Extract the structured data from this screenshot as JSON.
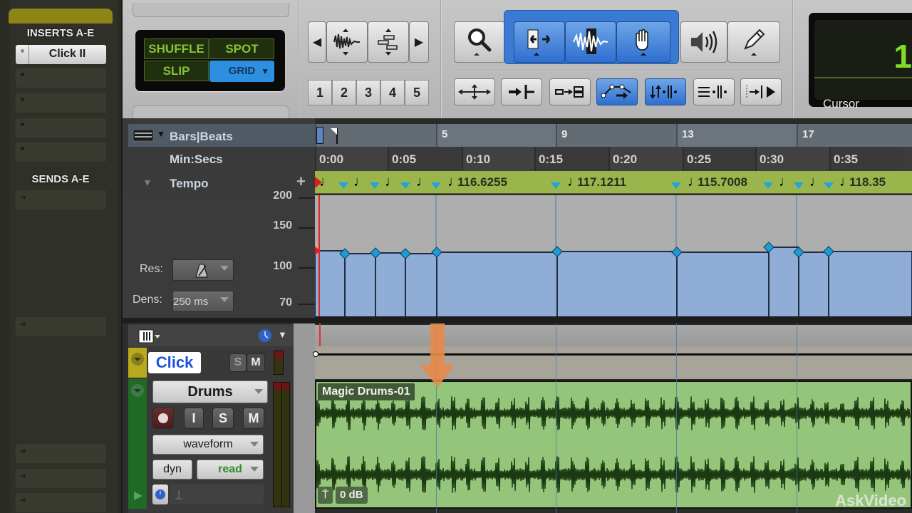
{
  "mixer": {
    "inserts_header": "INSERTS A-E",
    "inserts": [
      "Click II",
      "",
      "",
      "",
      ""
    ],
    "sends_header": "SENDS A-E",
    "send_slot_count": 5
  },
  "edit_modes": {
    "shuffle": "SHUFFLE",
    "spot": "SPOT",
    "slip": "SLIP",
    "grid": "GRID",
    "selected": "GRID"
  },
  "zoom_presets": [
    "1",
    "2",
    "3",
    "4",
    "5"
  ],
  "tools": {
    "zoomer": "zoom-tool",
    "trim": "trim-tool",
    "selector": "selector-tool",
    "grabber": "grabber-tool",
    "scrubber": "scrubber-tool",
    "pencil": "pencil-tool",
    "selected": [
      "trim-tool",
      "selector-tool",
      "grabber-tool"
    ]
  },
  "counter": {
    "value": "1",
    "label": "Cursor",
    "accent": "#7fdc23"
  },
  "rulers": {
    "bars_beats_label": "Bars|Beats",
    "min_secs_label": "Min:Secs",
    "tempo_label": "Tempo",
    "add_button": "+",
    "bars": [
      "5",
      "9",
      "13",
      "17"
    ],
    "min_secs": [
      "0:00",
      "0:05",
      "0:10",
      "0:15",
      "0:20",
      "0:25",
      "0:30",
      "0:35"
    ],
    "tempo_values": [
      "116.6255",
      "117.1211",
      "115.7008",
      "118.35"
    ]
  },
  "tempo_graph": {
    "y_labels": [
      "200",
      "150",
      "100",
      "70"
    ],
    "res_label": "Res:",
    "dens_label": "Dens:",
    "dens_value": "250 ms",
    "fill_color": "#8fadd6",
    "breakpoint_color": "#1e9ad6"
  },
  "tracks": [
    {
      "name": "Click",
      "color": "#b9a91c",
      "solo": "S",
      "mute": "M"
    },
    {
      "name": "Drums",
      "color": "#2b7a2e",
      "rec": "",
      "input": "I",
      "solo": "S",
      "mute": "M",
      "view": "waveform",
      "automation_dyn": "dyn",
      "automation_mode": "read",
      "clip_name": "Magic Drums-01",
      "clip_gain": "0 dB",
      "clip_color": "#95c57a"
    }
  ],
  "watermark": "AskVideo"
}
